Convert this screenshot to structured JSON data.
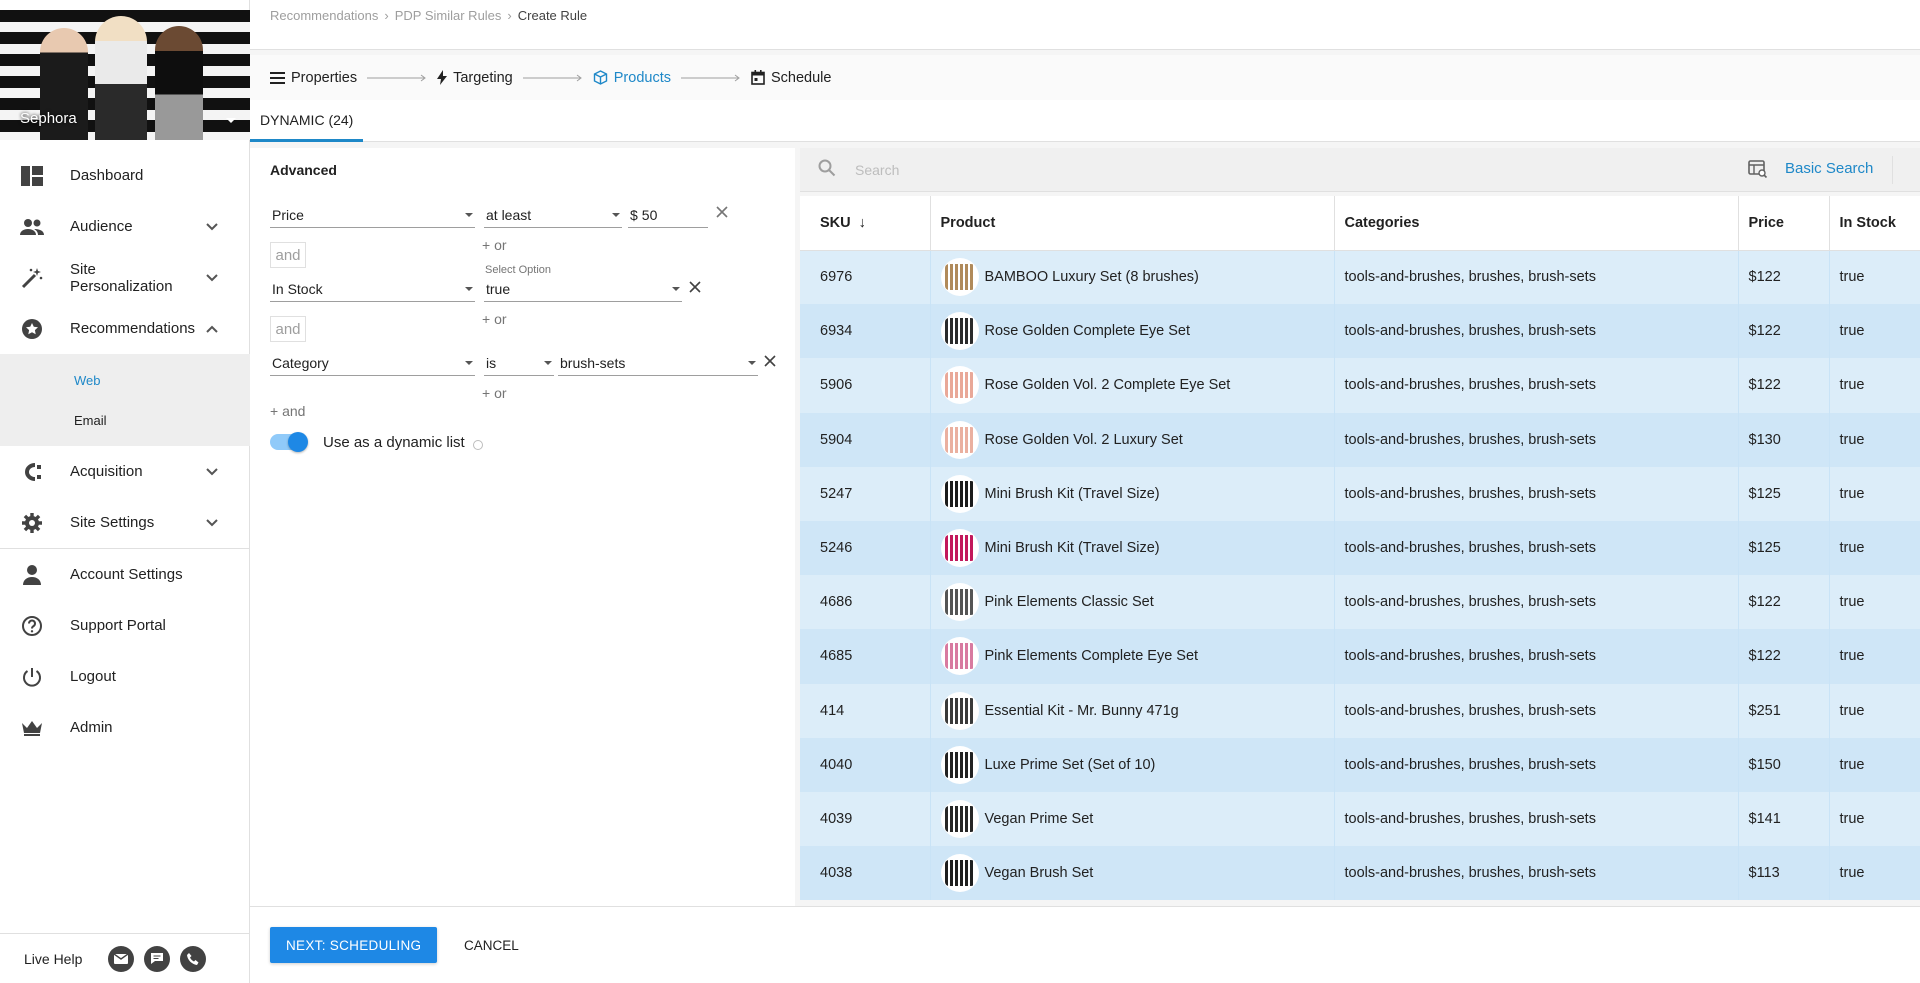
{
  "brand": {
    "name": "Sephora"
  },
  "nav": {
    "items": [
      {
        "label": "Dashboard",
        "icon": "dashboard-icon",
        "chevron": ""
      },
      {
        "label": "Audience",
        "icon": "people-icon",
        "chevron": "down"
      },
      {
        "label": "Site Personalization",
        "icon": "magic-wand-icon",
        "chevron": "down"
      },
      {
        "label": "Recommendations",
        "icon": "star-badge-icon",
        "chevron": "up"
      }
    ],
    "sub_items": [
      {
        "label": "Web",
        "active": true
      },
      {
        "label": "Email",
        "active": false
      }
    ],
    "items_after": [
      {
        "label": "Acquisition",
        "icon": "acquisition-icon",
        "chevron": "down"
      },
      {
        "label": "Site Settings",
        "icon": "gear-icon",
        "chevron": "down"
      },
      {
        "label": "Account Settings",
        "icon": "person-icon",
        "chevron": ""
      },
      {
        "label": "Support Portal",
        "icon": "help-icon",
        "chevron": ""
      },
      {
        "label": "Logout",
        "icon": "power-icon",
        "chevron": ""
      },
      {
        "label": "Admin",
        "icon": "crown-icon",
        "chevron": ""
      }
    ]
  },
  "live_help": {
    "label": "Live Help"
  },
  "breadcrumb": {
    "items": [
      "Recommendations",
      "PDP Similar Rules"
    ],
    "current": "Create Rule"
  },
  "stepper": {
    "steps": [
      {
        "label": "Properties",
        "active": false
      },
      {
        "label": "Targeting",
        "active": false
      },
      {
        "label": "Products",
        "active": true
      },
      {
        "label": "Schedule",
        "active": false
      }
    ]
  },
  "tabs": {
    "dynamic": "DYNAMIC (24)"
  },
  "filter": {
    "title": "Advanced",
    "rule1": {
      "field": "Price",
      "operator": "at least",
      "currency": "$",
      "value": "50"
    },
    "rule2": {
      "field": "In Stock",
      "value_label": "Select Option",
      "value": "true"
    },
    "rule3": {
      "field": "Category",
      "operator": "is",
      "value": "brush-sets"
    },
    "and_label": "and",
    "or_label": "+ or",
    "add_and_label": "+ and",
    "dynamic_list_label": "Use as a dynamic list",
    "dynamic_list_on": true
  },
  "search": {
    "placeholder": "Search",
    "basic_search": "Basic Search"
  },
  "table": {
    "headers": {
      "sku": "SKU",
      "sort_arrow": "↓",
      "product": "Product",
      "categories": "Categories",
      "price": "Price",
      "in_stock": "In Stock"
    },
    "rows": [
      {
        "sku": "6976",
        "product": "BAMBOO Luxury Set (8 brushes)",
        "categories": "tools-and-brushes, brushes, brush-sets",
        "price": "$122",
        "in_stock": "true",
        "thumb_color": "#b08a5a"
      },
      {
        "sku": "6934",
        "product": "Rose Golden Complete Eye Set",
        "categories": "tools-and-brushes, brushes, brush-sets",
        "price": "$122",
        "in_stock": "true",
        "thumb_color": "#2b2b2b"
      },
      {
        "sku": "5906",
        "product": "Rose Golden Vol. 2 Complete Eye Set",
        "categories": "tools-and-brushes, brushes, brush-sets",
        "price": "$122",
        "in_stock": "true",
        "thumb_color": "#e9a898"
      },
      {
        "sku": "5904",
        "product": "Rose Golden Vol. 2 Luxury Set",
        "categories": "tools-and-brushes, brushes, brush-sets",
        "price": "$130",
        "in_stock": "true",
        "thumb_color": "#eab0a0"
      },
      {
        "sku": "5247",
        "product": "Mini Brush Kit (Travel Size)",
        "categories": "tools-and-brushes, brushes, brush-sets",
        "price": "$125",
        "in_stock": "true",
        "thumb_color": "#1c1c1c"
      },
      {
        "sku": "5246",
        "product": "Mini Brush Kit (Travel Size)",
        "categories": "tools-and-brushes, brushes, brush-sets",
        "price": "$125",
        "in_stock": "true",
        "thumb_color": "#c2185b"
      },
      {
        "sku": "4686",
        "product": "Pink Elements Classic Set",
        "categories": "tools-and-brushes, brushes, brush-sets",
        "price": "$122",
        "in_stock": "true",
        "thumb_color": "#555555"
      },
      {
        "sku": "4685",
        "product": "Pink Elements Complete Eye Set",
        "categories": "tools-and-brushes, brushes, brush-sets",
        "price": "$122",
        "in_stock": "true",
        "thumb_color": "#d87aa0"
      },
      {
        "sku": "414",
        "product": "Essential Kit - Mr. Bunny 471g",
        "categories": "tools-and-brushes, brushes, brush-sets",
        "price": "$251",
        "in_stock": "true",
        "thumb_color": "#3a3a3a"
      },
      {
        "sku": "4040",
        "product": "Luxe Prime Set (Set of 10)",
        "categories": "tools-and-brushes, brushes, brush-sets",
        "price": "$150",
        "in_stock": "true",
        "thumb_color": "#222222"
      },
      {
        "sku": "4039",
        "product": "Vegan Prime Set",
        "categories": "tools-and-brushes, brushes, brush-sets",
        "price": "$141",
        "in_stock": "true",
        "thumb_color": "#262626"
      },
      {
        "sku": "4038",
        "product": "Vegan Brush Set",
        "categories": "tools-and-brushes, brushes, brush-sets",
        "price": "$113",
        "in_stock": "true",
        "thumb_color": "#1f1f1f"
      }
    ]
  },
  "footer": {
    "next_label": "NEXT: SCHEDULING",
    "cancel_label": "CANCEL"
  },
  "colors": {
    "accent": "#1e88c8",
    "primary_button": "#1e88e5",
    "row_odd": "#dcedf9",
    "row_even": "#cfe6f7"
  }
}
